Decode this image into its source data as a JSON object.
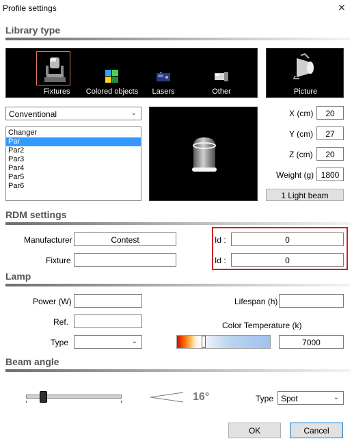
{
  "window": {
    "title": "Profile settings",
    "close_glyph": "✕"
  },
  "library": {
    "heading": "Library type",
    "items": [
      {
        "label": "Fixtures",
        "icon": "moving-head-icon",
        "selected": true
      },
      {
        "label": "Colored objects",
        "icon": "colored-objects-icon"
      },
      {
        "label": "Lasers",
        "icon": "laser-icon"
      },
      {
        "label": "Other",
        "icon": "other-fixture-icon"
      }
    ],
    "picture_label": "Picture"
  },
  "fixture_type": {
    "value": "Conventional"
  },
  "model_list": {
    "items": [
      "Changer",
      "Par",
      "Par2",
      "Par3",
      "Par4",
      "Par5",
      "Par6"
    ],
    "selected": "Par"
  },
  "dims": {
    "x_label": "X (cm)",
    "x_value": "20",
    "y_label": "Y (cm)",
    "y_value": "27",
    "z_label": "Z (cm)",
    "z_value": "20",
    "weight_label": "Weight (g)",
    "weight_value": "1800",
    "beam_button": "1 Light beam"
  },
  "rdm": {
    "heading": "RDM settings",
    "manufacturer_label": "Manufacturer",
    "manufacturer_value": "Contest",
    "fixture_label": "Fixture",
    "fixture_value": "",
    "id1_label": "Id :",
    "id1_value": "0",
    "id2_label": "Id :",
    "id2_value": "0"
  },
  "lamp": {
    "heading": "Lamp",
    "power_label": "Power (W)",
    "power_value": "",
    "ref_label": "Ref.",
    "ref_value": "",
    "type_label": "Type",
    "type_value": "",
    "lifespan_label": "Lifespan (h)",
    "lifespan_value": "",
    "color_temp_label": "Color Temperature (k)",
    "color_temp_value": "7000"
  },
  "beam": {
    "heading": "Beam angle",
    "angle_text": "16°",
    "type_label": "Type",
    "type_value": "Spot"
  },
  "buttons": {
    "ok": "OK",
    "cancel": "Cancel"
  }
}
